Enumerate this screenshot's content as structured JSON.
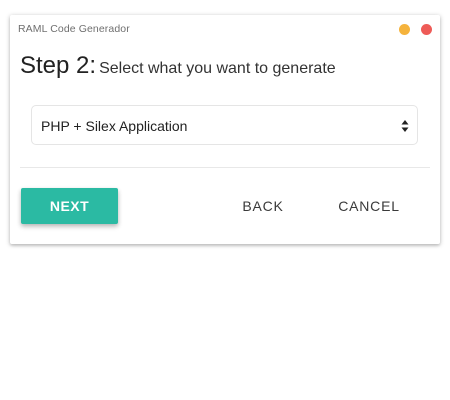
{
  "window": {
    "title": "RAML Code Generador",
    "controls": {
      "minimize_color": "#f5b33c",
      "close_color": "#ee5b57"
    }
  },
  "step": {
    "label": "Step 2:",
    "instruction": "Select what you want to generate"
  },
  "generator_select": {
    "selected": "PHP + Silex Application",
    "icon": "select-updown-arrows-icon"
  },
  "actions": {
    "next_label": "NEXT",
    "back_label": "BACK",
    "cancel_label": "CANCEL",
    "accent_color": "#2bbaa3"
  }
}
